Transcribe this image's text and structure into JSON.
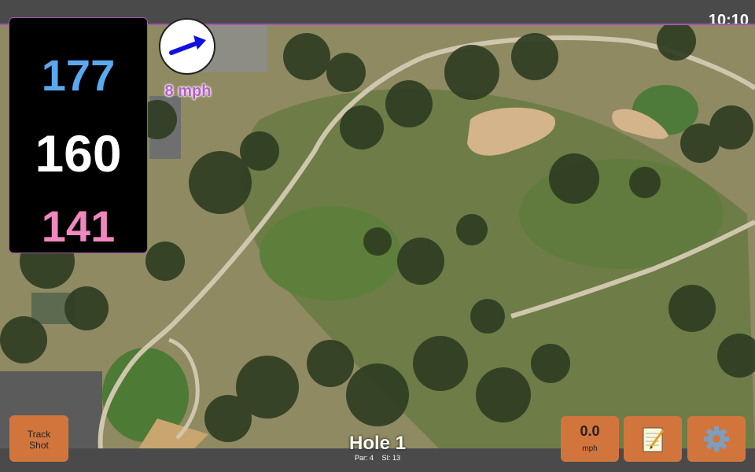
{
  "status": {
    "time": "10:10"
  },
  "distances": {
    "back": "177",
    "middle": "160",
    "front": "141"
  },
  "wind": {
    "speed_label": "8 mph",
    "direction": "arrow-right-up-icon"
  },
  "hole": {
    "title": "Hole 1",
    "par_label": "Par: 4",
    "si_label": "SI: 13"
  },
  "buttons": {
    "track_shot": "Track Shot",
    "wind_value": "0.0",
    "wind_unit": "mph",
    "notes_icon": "notepad-icon",
    "settings_icon": "gear-icon"
  },
  "colors": {
    "back": "#5aa9ef",
    "middle": "#ffffff",
    "front": "#f087be",
    "accent": "#a256b2",
    "button": "#d2753d"
  }
}
